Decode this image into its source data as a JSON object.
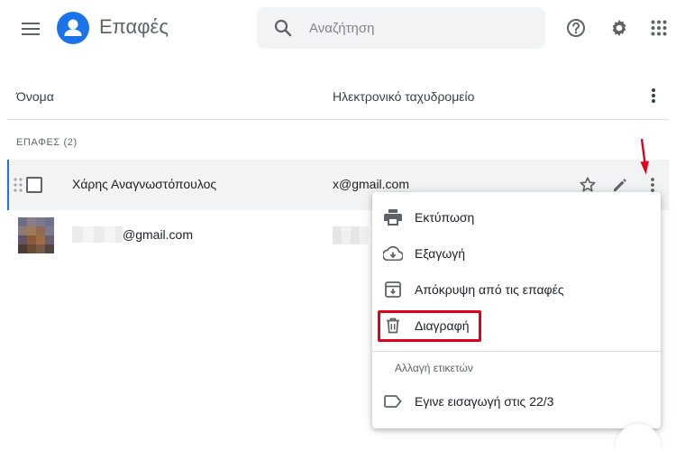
{
  "header": {
    "title": "Επαφές",
    "search_placeholder": "Αναζήτηση",
    "icons": [
      "menu-icon",
      "contacts-logo-icon",
      "search-icon",
      "help-icon",
      "settings-icon",
      "apps-icon"
    ]
  },
  "columns": {
    "name": "Όνομα",
    "email": "Ηλεκτρονικό ταχυδρομείο"
  },
  "section_label": "ΕΠΑΦΕΣ (2)",
  "contacts": [
    {
      "name": "Χάρης Αναγνωστόπουλος",
      "email": "x@gmail.com",
      "selected_row": true
    },
    {
      "name": "@gmail.com",
      "email": ""
    }
  ],
  "menu": {
    "items": [
      {
        "label": "Εκτύπωση",
        "icon": "print-icon"
      },
      {
        "label": "Εξαγωγή",
        "icon": "cloud-download-icon"
      },
      {
        "label": "Απόκρυψη από τις επαφές",
        "icon": "archive-icon"
      },
      {
        "label": "Διαγραφή",
        "icon": "trash-icon"
      }
    ],
    "subheader": "Αλλαγή ετικετών",
    "label_item": {
      "label": "Εγινε εισαγωγή στις 22/3",
      "icon": "label-icon"
    }
  },
  "colors": {
    "accent": "#1a73e8",
    "annotation_red": "#e0001b",
    "row_hover": "#f1f3f4"
  }
}
